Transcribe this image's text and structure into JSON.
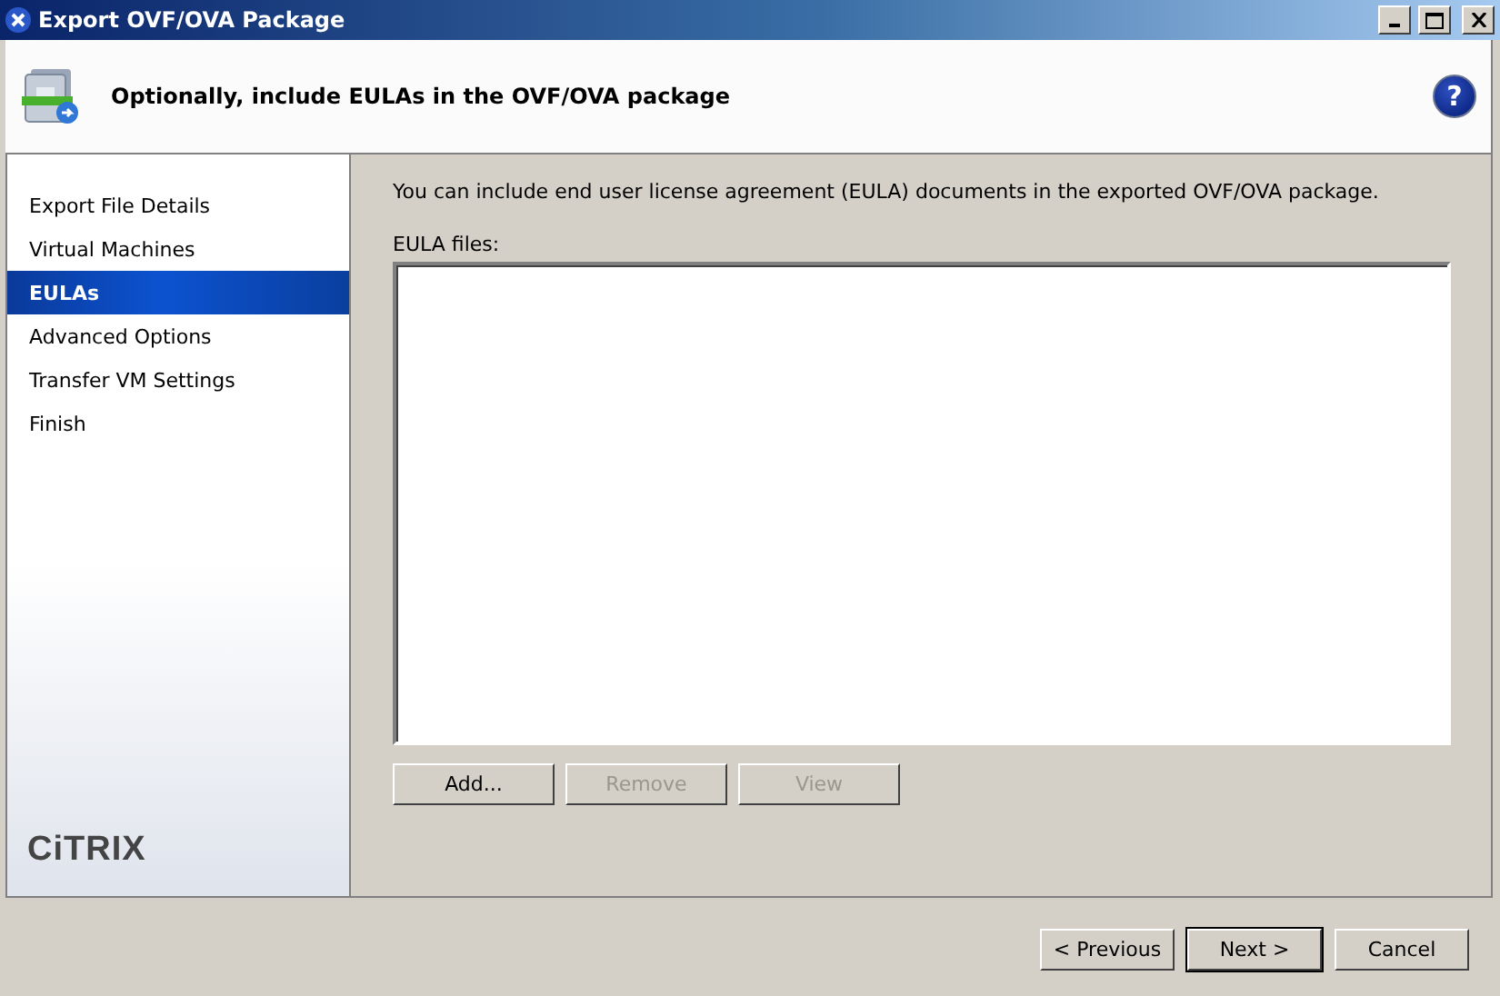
{
  "window": {
    "title": "Export OVF/OVA Package"
  },
  "header": {
    "title": "Optionally, include EULAs in the OVF/OVA package",
    "help": "?"
  },
  "sidebar": {
    "items": [
      {
        "label": "Export File Details",
        "selected": false
      },
      {
        "label": "Virtual Machines",
        "selected": false
      },
      {
        "label": "EULAs",
        "selected": true
      },
      {
        "label": "Advanced Options",
        "selected": false
      },
      {
        "label": "Transfer VM Settings",
        "selected": false
      },
      {
        "label": "Finish",
        "selected": false
      }
    ],
    "logo": "CiTRIX"
  },
  "content": {
    "description": "You can include end user license agreement (EULA) documents in the exported OVF/OVA package.",
    "list_label": "EULA files:",
    "buttons": [
      {
        "label": "Add...",
        "disabled": false
      },
      {
        "label": "Remove",
        "disabled": true
      },
      {
        "label": "View",
        "disabled": true
      }
    ]
  },
  "footer": {
    "buttons": [
      {
        "label": "< Previous",
        "default": false
      },
      {
        "label": "Next >",
        "default": true
      },
      {
        "label": "Cancel",
        "default": false
      }
    ]
  }
}
